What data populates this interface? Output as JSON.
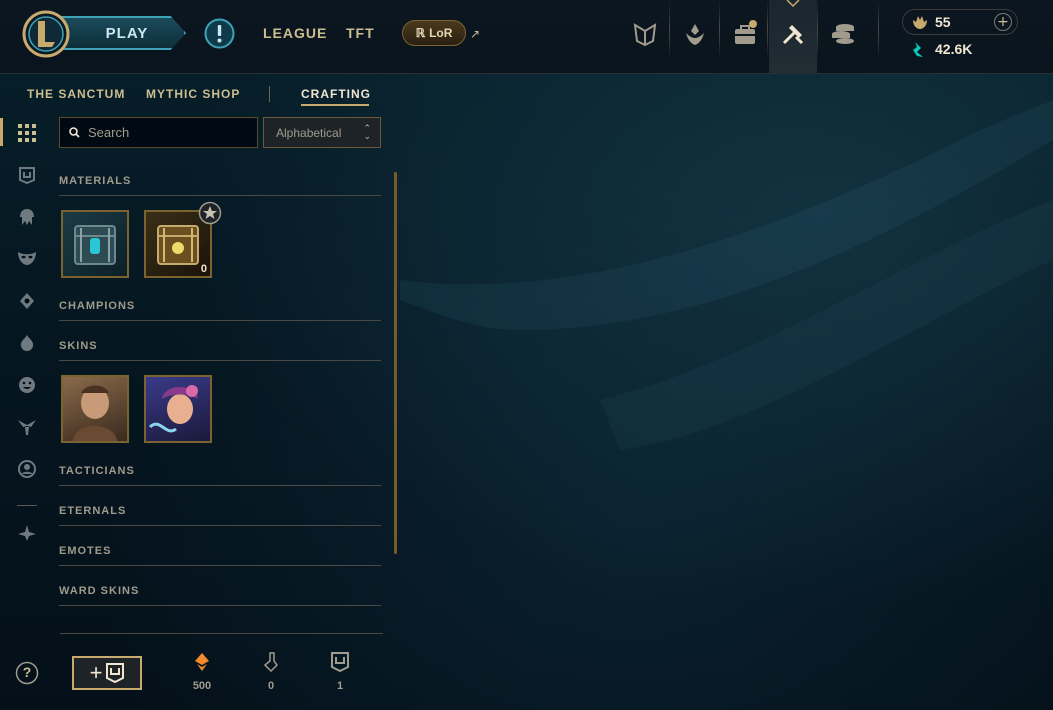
{
  "header": {
    "play_label": "PLAY",
    "nav": [
      "LEAGUE",
      "TFT"
    ],
    "lor_label": "LoR",
    "ext_arrow": "↗",
    "top_icons": [
      "clash-icon",
      "ranked-icon",
      "collection-icon",
      "loot-icon",
      "store-icon"
    ],
    "notification_color": "#c8aa6e",
    "orange_essence": "55",
    "blue_essence": "42.6K",
    "add_label": "+"
  },
  "subnav": {
    "items": [
      "THE SANCTUM",
      "MYTHIC SHOP",
      "CRAFTING"
    ],
    "active": "CRAFTING"
  },
  "loot": {
    "search_placeholder": "Search",
    "sort_value": "Alphabetical",
    "sections": [
      "MATERIALS",
      "CHAMPIONS",
      "SKINS",
      "TACTICIANS",
      "ETERNALS",
      "EMOTES",
      "WARD SKINS"
    ],
    "materials": [
      {
        "name": "hextech-chest-icon",
        "count": ""
      },
      {
        "name": "masterwork-chest-icon",
        "count": "0"
      }
    ],
    "skins": [
      {
        "name": "skin-tile-1"
      },
      {
        "name": "skin-tile-2"
      }
    ]
  },
  "footer": {
    "add_icon_label": "+",
    "help_label": "?",
    "orange_essence": "500",
    "keys": "0",
    "chests": "1"
  },
  "colors": {
    "gold": "#c8aa6e",
    "gold_light": "#f0e6d2",
    "accent_blue": "#0ac8b9",
    "bg": "#010a13"
  }
}
